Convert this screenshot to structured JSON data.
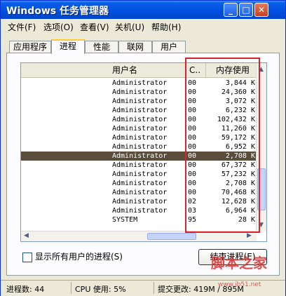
{
  "window": {
    "title": "Windows 任务管理器",
    "minimize": "_",
    "maximize": "□",
    "close": "✕"
  },
  "menu": [
    "文件(F)",
    "选项(O)",
    "查看(V)",
    "关机(U)",
    "帮助(H)"
  ],
  "tabs": [
    {
      "label": "应用程序",
      "active": false
    },
    {
      "label": "进程",
      "active": true
    },
    {
      "label": "性能",
      "active": false
    },
    {
      "label": "联网",
      "active": false
    },
    {
      "label": "用户",
      "active": false
    }
  ],
  "columns": {
    "user": "用户名",
    "cpu": "C..",
    "memory": "内存使用"
  },
  "rows": [
    {
      "user": "Administrator",
      "cpu": "00",
      "mem": "3,844 K",
      "selected": false
    },
    {
      "user": "Administrator",
      "cpu": "00",
      "mem": "24,360 K",
      "selected": false
    },
    {
      "user": "Administrator",
      "cpu": "00",
      "mem": "3,072 K",
      "selected": false
    },
    {
      "user": "Administrator",
      "cpu": "00",
      "mem": "6,232 K",
      "selected": false
    },
    {
      "user": "Administrator",
      "cpu": "00",
      "mem": "102,432 K",
      "selected": false
    },
    {
      "user": "Administrator",
      "cpu": "00",
      "mem": "11,260 K",
      "selected": false
    },
    {
      "user": "Administrator",
      "cpu": "00",
      "mem": "59,172 K",
      "selected": false
    },
    {
      "user": "Administrator",
      "cpu": "00",
      "mem": "6,952 K",
      "selected": false
    },
    {
      "user": "Administrator",
      "cpu": "00",
      "mem": "2,708 K",
      "selected": true
    },
    {
      "user": "Administrator",
      "cpu": "00",
      "mem": "67,372 K",
      "selected": false
    },
    {
      "user": "Administrator",
      "cpu": "00",
      "mem": "57,232 K",
      "selected": false
    },
    {
      "user": "Administrator",
      "cpu": "00",
      "mem": "2,708 K",
      "selected": false
    },
    {
      "user": "Administrator",
      "cpu": "00",
      "mem": "70,468 K",
      "selected": false
    },
    {
      "user": "Administrator",
      "cpu": "02",
      "mem": "12,628 K",
      "selected": false
    },
    {
      "user": "Administrator",
      "cpu": "03",
      "mem": "6,964 K",
      "selected": false
    },
    {
      "user": "SYSTEM",
      "cpu": "95",
      "mem": "28 K",
      "selected": false
    }
  ],
  "show_all_users": "显示所有用户的进程(S)",
  "end_process": "结束进程(E)",
  "status": {
    "processes": "进程数: 44",
    "cpu": "CPU 使用: 5%",
    "commit": "提交更改: 419M / 895M"
  },
  "watermark": "脚本之家",
  "watermark_url": "www.jb51.net",
  "highlight_color": "#d9232d",
  "selected_row_color": "#5a4d3c"
}
